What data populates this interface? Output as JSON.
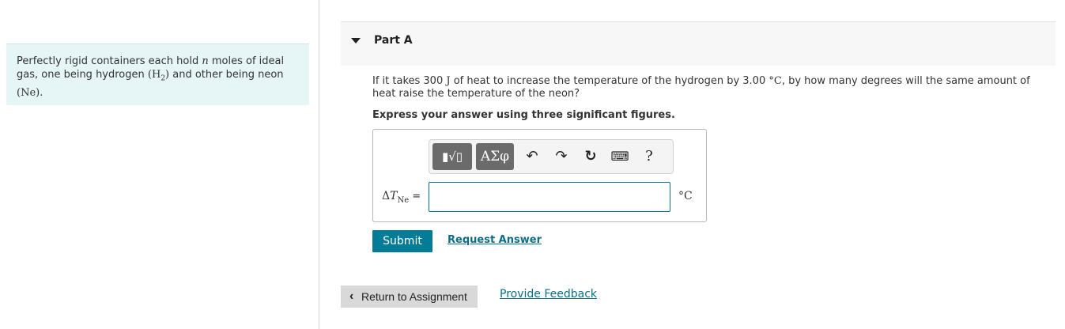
{
  "intro": {
    "text_a": "Perfectly rigid containers each hold ",
    "n": "n",
    "text_b": " moles of ideal gas, one being hydrogen ",
    "h2": "(H",
    "h2_sub": "2",
    "h2_close": ")",
    "text_c": " and other being neon ",
    "ne": "(Ne)",
    "text_d": "."
  },
  "part": {
    "title": "Part A"
  },
  "question": {
    "a": "If it takes 300 ",
    "unit_j": "J",
    "b": " of heat to increase the temperature of the hydrogen by 3.00 ",
    "unit_c": "°C",
    "c": ", by how many degrees will the same amount of heat raise the temperature of the neon?"
  },
  "instruction": "Express your answer using three significant figures.",
  "toolbar": {
    "template_symbol": "▮√▯",
    "greek_symbol": "ΑΣφ",
    "undo": "↶",
    "redo": "↷",
    "reset": "↻",
    "keyboard": "⌨",
    "help": "?"
  },
  "answer": {
    "label_delta": "Δ",
    "label_T": "T",
    "label_sub": "Ne",
    "label_eq": " =",
    "value": "",
    "unit": "°C"
  },
  "buttons": {
    "submit": "Submit",
    "request_answer": "Request Answer",
    "return": "Return to Assignment",
    "feedback": "Provide Feedback"
  }
}
